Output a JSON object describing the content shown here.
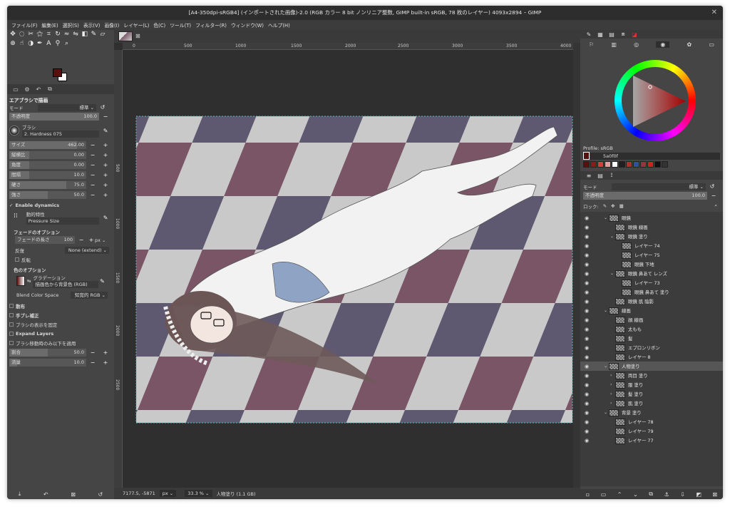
{
  "window": {
    "title": "[A4-350dpi-sRGB4] (インポートされた画像)-2.0 (RGB カラー 8 bit ノンリニア整数, GIMP built-in sRGB, 78 枚のレイヤー) 4093x2894 – GIMP",
    "close_glyph": "✕"
  },
  "menu": [
    "ファイル(F)",
    "編集(E)",
    "選択(S)",
    "表示(V)",
    "画像(I)",
    "レイヤー(L)",
    "色(C)",
    "ツール(T)",
    "フィルター(R)",
    "ウィンドウ(W)",
    "ヘルプ(H)"
  ],
  "colors": {
    "foreground": "#5a0f0f",
    "background": "#ffffff",
    "accent_red": "#cc0000"
  },
  "tool_options": {
    "title": "エアブラシで描画",
    "mode_label": "モード",
    "mode_value": "標準 ⌄",
    "opacity": {
      "label": "不透明度",
      "value": "100.0"
    },
    "brush_label": "ブラシ",
    "brush_value": "2. Hardness 075",
    "size": {
      "label": "サイズ",
      "value": "462.00"
    },
    "aspect": {
      "label": "縦横比",
      "value": "0.00"
    },
    "angle": {
      "label": "角度",
      "value": "0.00"
    },
    "spacing": {
      "label": "間隔",
      "value": "10.0"
    },
    "hardness": {
      "label": "硬さ",
      "value": "75.0"
    },
    "force": {
      "label": "強さ",
      "value": "50.0"
    },
    "enable_dynamics": "Enable dynamics",
    "dynamics_label": "動的特性",
    "dynamics_value": "Pressure Size",
    "fade_title": "フェードのオプション",
    "fade_length": {
      "label": "フェードの長さ",
      "value": "100",
      "unit": "px ⌄"
    },
    "repeat": {
      "label": "反復",
      "value": "None (extend) ⌄"
    },
    "reverse": "反転",
    "color_title": "色のオプション",
    "gradient_label": "グラデーション",
    "gradient_value": "描画色から背景色 (RGB)",
    "blend_label": "Blend Color Space",
    "blend_value": "知覚的 RGB ⌄",
    "scatter": "散布",
    "smooth": "手ブレ補正",
    "lock_brush": "ブラシの表示を固定",
    "expand_layers": "Expand Layers",
    "below": "ブラシ移動時のみ以下を適用",
    "rate": {
      "label": "割合",
      "value": "50.0"
    },
    "flow": {
      "label": "流量",
      "value": "10.0"
    }
  },
  "ruler": {
    "h": [
      "0",
      "500",
      "1000",
      "1500",
      "2000",
      "2500",
      "3000",
      "3500",
      "4000"
    ],
    "v": [
      "500",
      "1000",
      "1500",
      "2000",
      "2500"
    ]
  },
  "status": {
    "coords": "7177.5, -5871",
    "unit": "px ⌄",
    "zoom": "33.3 % ⌄",
    "layer": "人物塗り (1.1 GB)"
  },
  "color_panel": {
    "profile": "Profile: sRGB",
    "hex": "5a0f0f"
  },
  "palette": [
    "#5a0f0f",
    "#8a1c1c",
    "#d04040",
    "#e0a0a0",
    "#ffffff",
    "#202020",
    "#b03030",
    "#3050a0",
    "#a03040",
    "#cc2222",
    "#111111",
    "#333333"
  ],
  "layers_panel": {
    "mode_label": "モード",
    "mode_value": "標準 ⌄",
    "opacity_label": "不透明度",
    "opacity_value": "100.0",
    "lock_label": "ロック:",
    "items": [
      {
        "depth": 1,
        "arrow": "⌄",
        "name": "眼鏡"
      },
      {
        "depth": 2,
        "arrow": "",
        "name": "眼鏡 線画"
      },
      {
        "depth": 2,
        "arrow": "⌄",
        "name": "眼鏡 塗り"
      },
      {
        "depth": 3,
        "arrow": "",
        "name": "レイヤー 74"
      },
      {
        "depth": 3,
        "arrow": "",
        "name": "レイヤー 75"
      },
      {
        "depth": 3,
        "arrow": "",
        "name": "眼鏡 下地"
      },
      {
        "depth": 2,
        "arrow": "⌄",
        "name": "眼鏡 鼻あて レンズ"
      },
      {
        "depth": 3,
        "arrow": "",
        "name": "レイヤー 73"
      },
      {
        "depth": 3,
        "arrow": "",
        "name": "眼鏡 鼻あて 塗り"
      },
      {
        "depth": 2,
        "arrow": "",
        "name": "眼鏡 肌 陰影"
      },
      {
        "depth": 1,
        "arrow": "⌄",
        "name": "線画"
      },
      {
        "depth": 2,
        "arrow": "",
        "name": "顔 線画"
      },
      {
        "depth": 2,
        "arrow": "",
        "name": "太もも"
      },
      {
        "depth": 2,
        "arrow": "",
        "name": "髪"
      },
      {
        "depth": 2,
        "arrow": "",
        "name": "エプロンリボン"
      },
      {
        "depth": 2,
        "arrow": "",
        "name": "レイヤー 8"
      },
      {
        "depth": 1,
        "arrow": "⌄",
        "name": "人物塗り",
        "selected": true
      },
      {
        "depth": 2,
        "arrow": "›",
        "name": "両目 塗り"
      },
      {
        "depth": 2,
        "arrow": "›",
        "name": "服 塗り"
      },
      {
        "depth": 2,
        "arrow": "›",
        "name": "髪 塗り"
      },
      {
        "depth": 2,
        "arrow": "›",
        "name": "肌 塗り"
      },
      {
        "depth": 1,
        "arrow": "⌄",
        "name": "背景 塗り"
      },
      {
        "depth": 2,
        "arrow": "",
        "name": "レイヤー 78"
      },
      {
        "depth": 2,
        "arrow": "",
        "name": "レイヤー 79"
      },
      {
        "depth": 2,
        "arrow": "",
        "name": "レイヤー 77"
      }
    ]
  }
}
